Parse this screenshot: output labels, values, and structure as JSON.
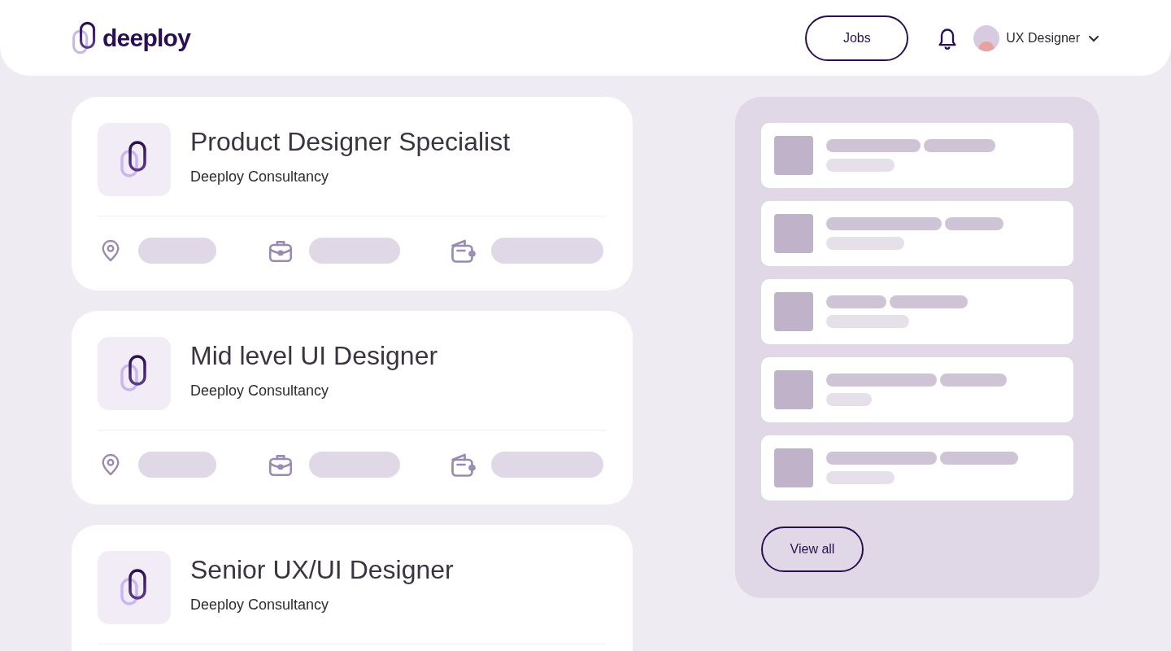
{
  "header": {
    "brand": "deeploy",
    "jobs_button": "Jobs",
    "user": {
      "name": "UX Designer"
    }
  },
  "jobs": [
    {
      "title": "Product Designer Specialist",
      "company": "Deeploy Consultancy"
    },
    {
      "title": "Mid level UI Designer",
      "company": "Deeploy Consultancy"
    },
    {
      "title": "Senior UX/UI Designer",
      "company": "Deeploy Consultancy"
    }
  ],
  "side_panel": {
    "button": "View all"
  }
}
